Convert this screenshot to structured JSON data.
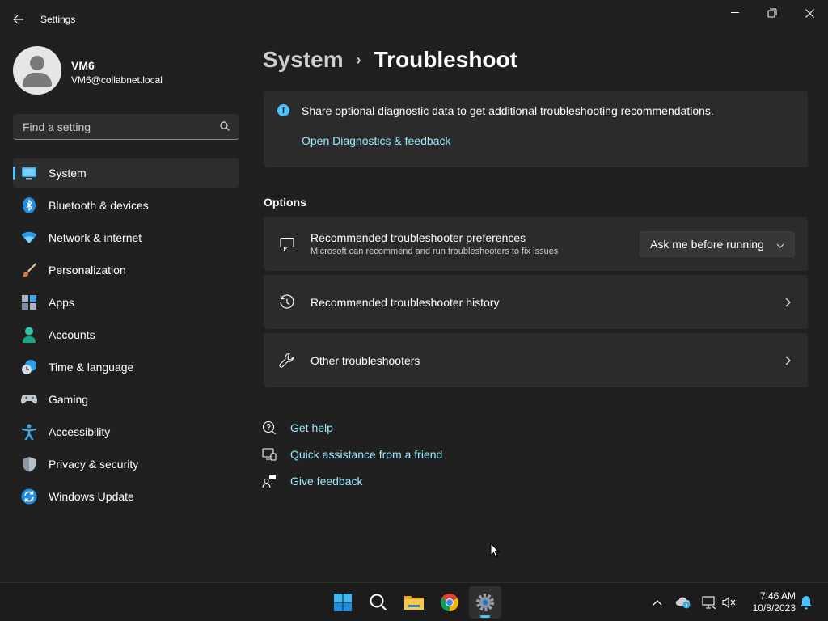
{
  "window": {
    "title": "Settings"
  },
  "profile": {
    "name": "VM6",
    "email": "VM6@collabnet.local"
  },
  "search": {
    "placeholder": "Find a setting"
  },
  "nav": [
    {
      "label": "System",
      "icon": "system-icon",
      "active": true
    },
    {
      "label": "Bluetooth & devices",
      "icon": "bluetooth-icon"
    },
    {
      "label": "Network & internet",
      "icon": "wifi-icon"
    },
    {
      "label": "Personalization",
      "icon": "brush-icon"
    },
    {
      "label": "Apps",
      "icon": "apps-icon"
    },
    {
      "label": "Accounts",
      "icon": "person-icon"
    },
    {
      "label": "Time & language",
      "icon": "clock-globe-icon"
    },
    {
      "label": "Gaming",
      "icon": "controller-icon"
    },
    {
      "label": "Accessibility",
      "icon": "accessibility-icon"
    },
    {
      "label": "Privacy & security",
      "icon": "shield-icon"
    },
    {
      "label": "Windows Update",
      "icon": "update-icon"
    }
  ],
  "breadcrumb": {
    "parent": "System",
    "separator": "›",
    "current": "Troubleshoot"
  },
  "info": {
    "text": "Share optional diagnostic data to get additional troubleshooting recommendations.",
    "link": "Open Diagnostics & feedback"
  },
  "options": {
    "heading": "Options",
    "preferences": {
      "title": "Recommended troubleshooter preferences",
      "subtitle": "Microsoft can recommend and run troubleshooters to fix issues",
      "dropdown_value": "Ask me before running"
    },
    "history": {
      "title": "Recommended troubleshooter history"
    },
    "other": {
      "title": "Other troubleshooters"
    }
  },
  "help_links": [
    "Get help",
    "Quick assistance from a friend",
    "Give feedback"
  ],
  "taskbar": {
    "apps": [
      "start-icon",
      "search-icon",
      "file-explorer-icon",
      "chrome-icon",
      "settings-icon"
    ],
    "time": "7:46 AM",
    "date": "10/8/2023"
  },
  "colors": {
    "accent": "#4cc2ff",
    "link": "#99ebff",
    "background": "#202020",
    "card": "#2b2b2b"
  }
}
